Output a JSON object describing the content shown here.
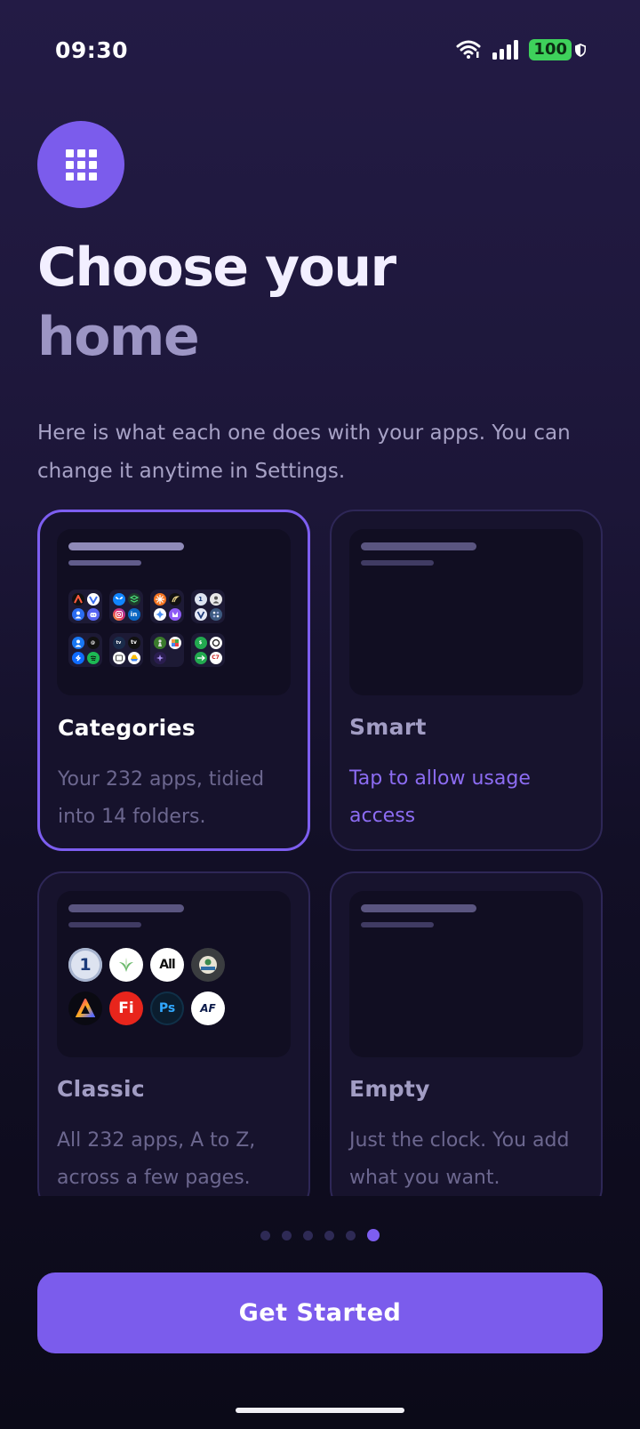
{
  "status_bar": {
    "time": "09:30",
    "battery": "100"
  },
  "header": {
    "title_line1": "Choose your",
    "title_line2": "home",
    "subtitle": "Here is what each one does with your apps. You can change it anytime in Settings."
  },
  "cards": [
    {
      "name": "Categories",
      "description": "Your 232 apps, tidied into 14 folders.",
      "selected": true
    },
    {
      "name": "Smart",
      "description": "Tap to allow usage access",
      "selected": false
    },
    {
      "name": "Classic",
      "description": "All 232 apps, A to Z, across a few pages.",
      "selected": false
    },
    {
      "name": "Empty",
      "description": "Just the clock. You add what you want.",
      "selected": false
    }
  ],
  "classic_preview_labels": {
    "1password": "1",
    "all": "All",
    "fi": "Fi",
    "ps": "Ps",
    "af": "AF"
  },
  "pagination": {
    "total": 6,
    "active_index": 5
  },
  "cta": {
    "label": "Get Started"
  },
  "colors": {
    "accent": "#7b5cec",
    "selected_border": "#7d5ef0",
    "link": "#8c6cf2",
    "battery": "#3ed15b"
  }
}
